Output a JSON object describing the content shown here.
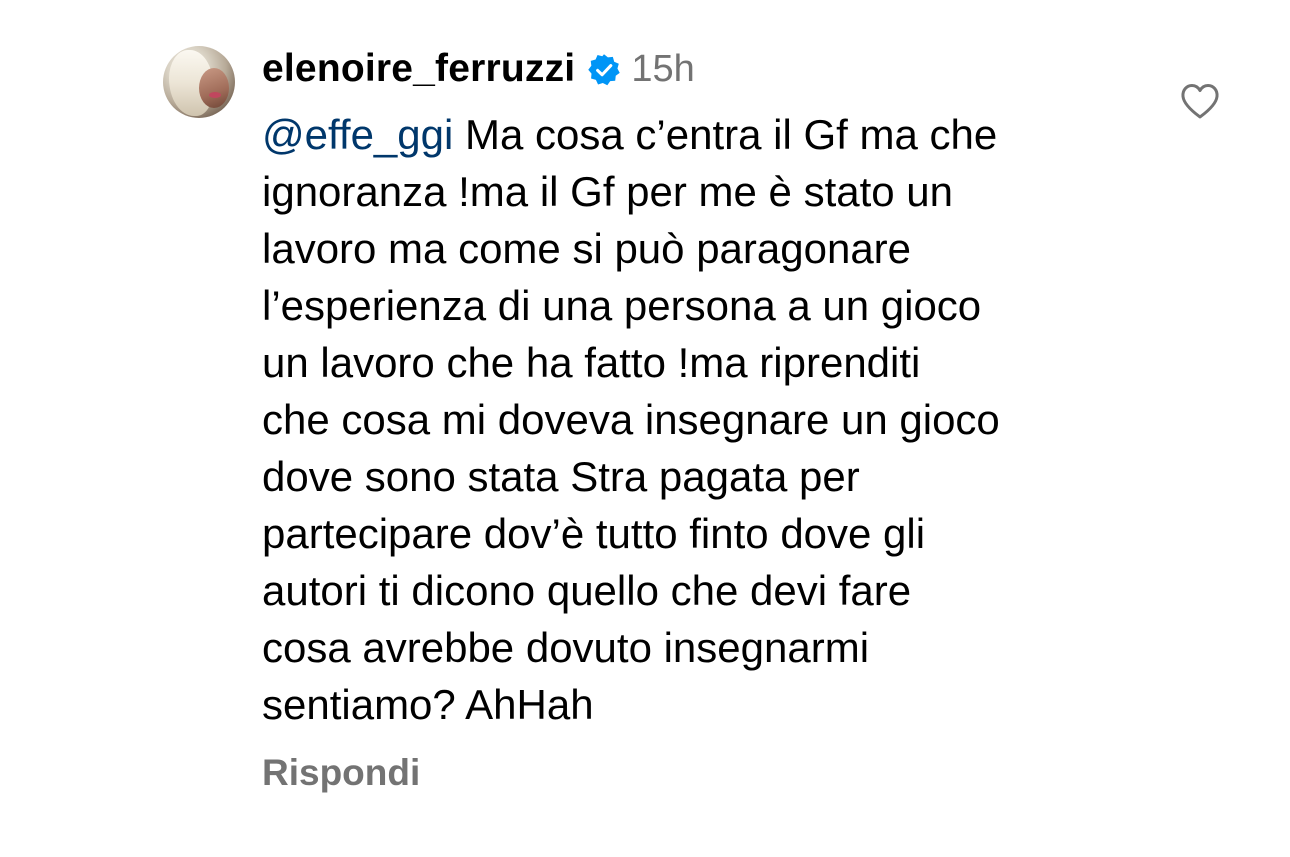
{
  "comment": {
    "username": "elenoire_ferruzzi",
    "verified": true,
    "timestamp": "15h",
    "mention": "@effe_ggi",
    "lines": [
      "Ma cosa c’entra il Gf ma che",
      "ignoranza !ma il Gf per me è stato un",
      "lavoro ma come si può paragonare",
      "l’esperienza di una persona a un gioco",
      "un lavoro che ha fatto !ma riprenditi",
      "che cosa mi doveva insegnare un gioco",
      "dove sono stata Stra pagata per",
      "partecipare dov’è tutto finto dove gli",
      "autori ti dicono quello che devi fare",
      "cosa avrebbe dovuto insegnarmi",
      "sentiamo? AhHah"
    ],
    "reply_label": "Rispondi"
  },
  "icons": {
    "verified": "verified-badge-icon",
    "like": "heart-outline-icon"
  },
  "colors": {
    "text": "#000000",
    "mention": "#00376b",
    "muted": "#737373",
    "verified_badge": "#0095f6"
  }
}
